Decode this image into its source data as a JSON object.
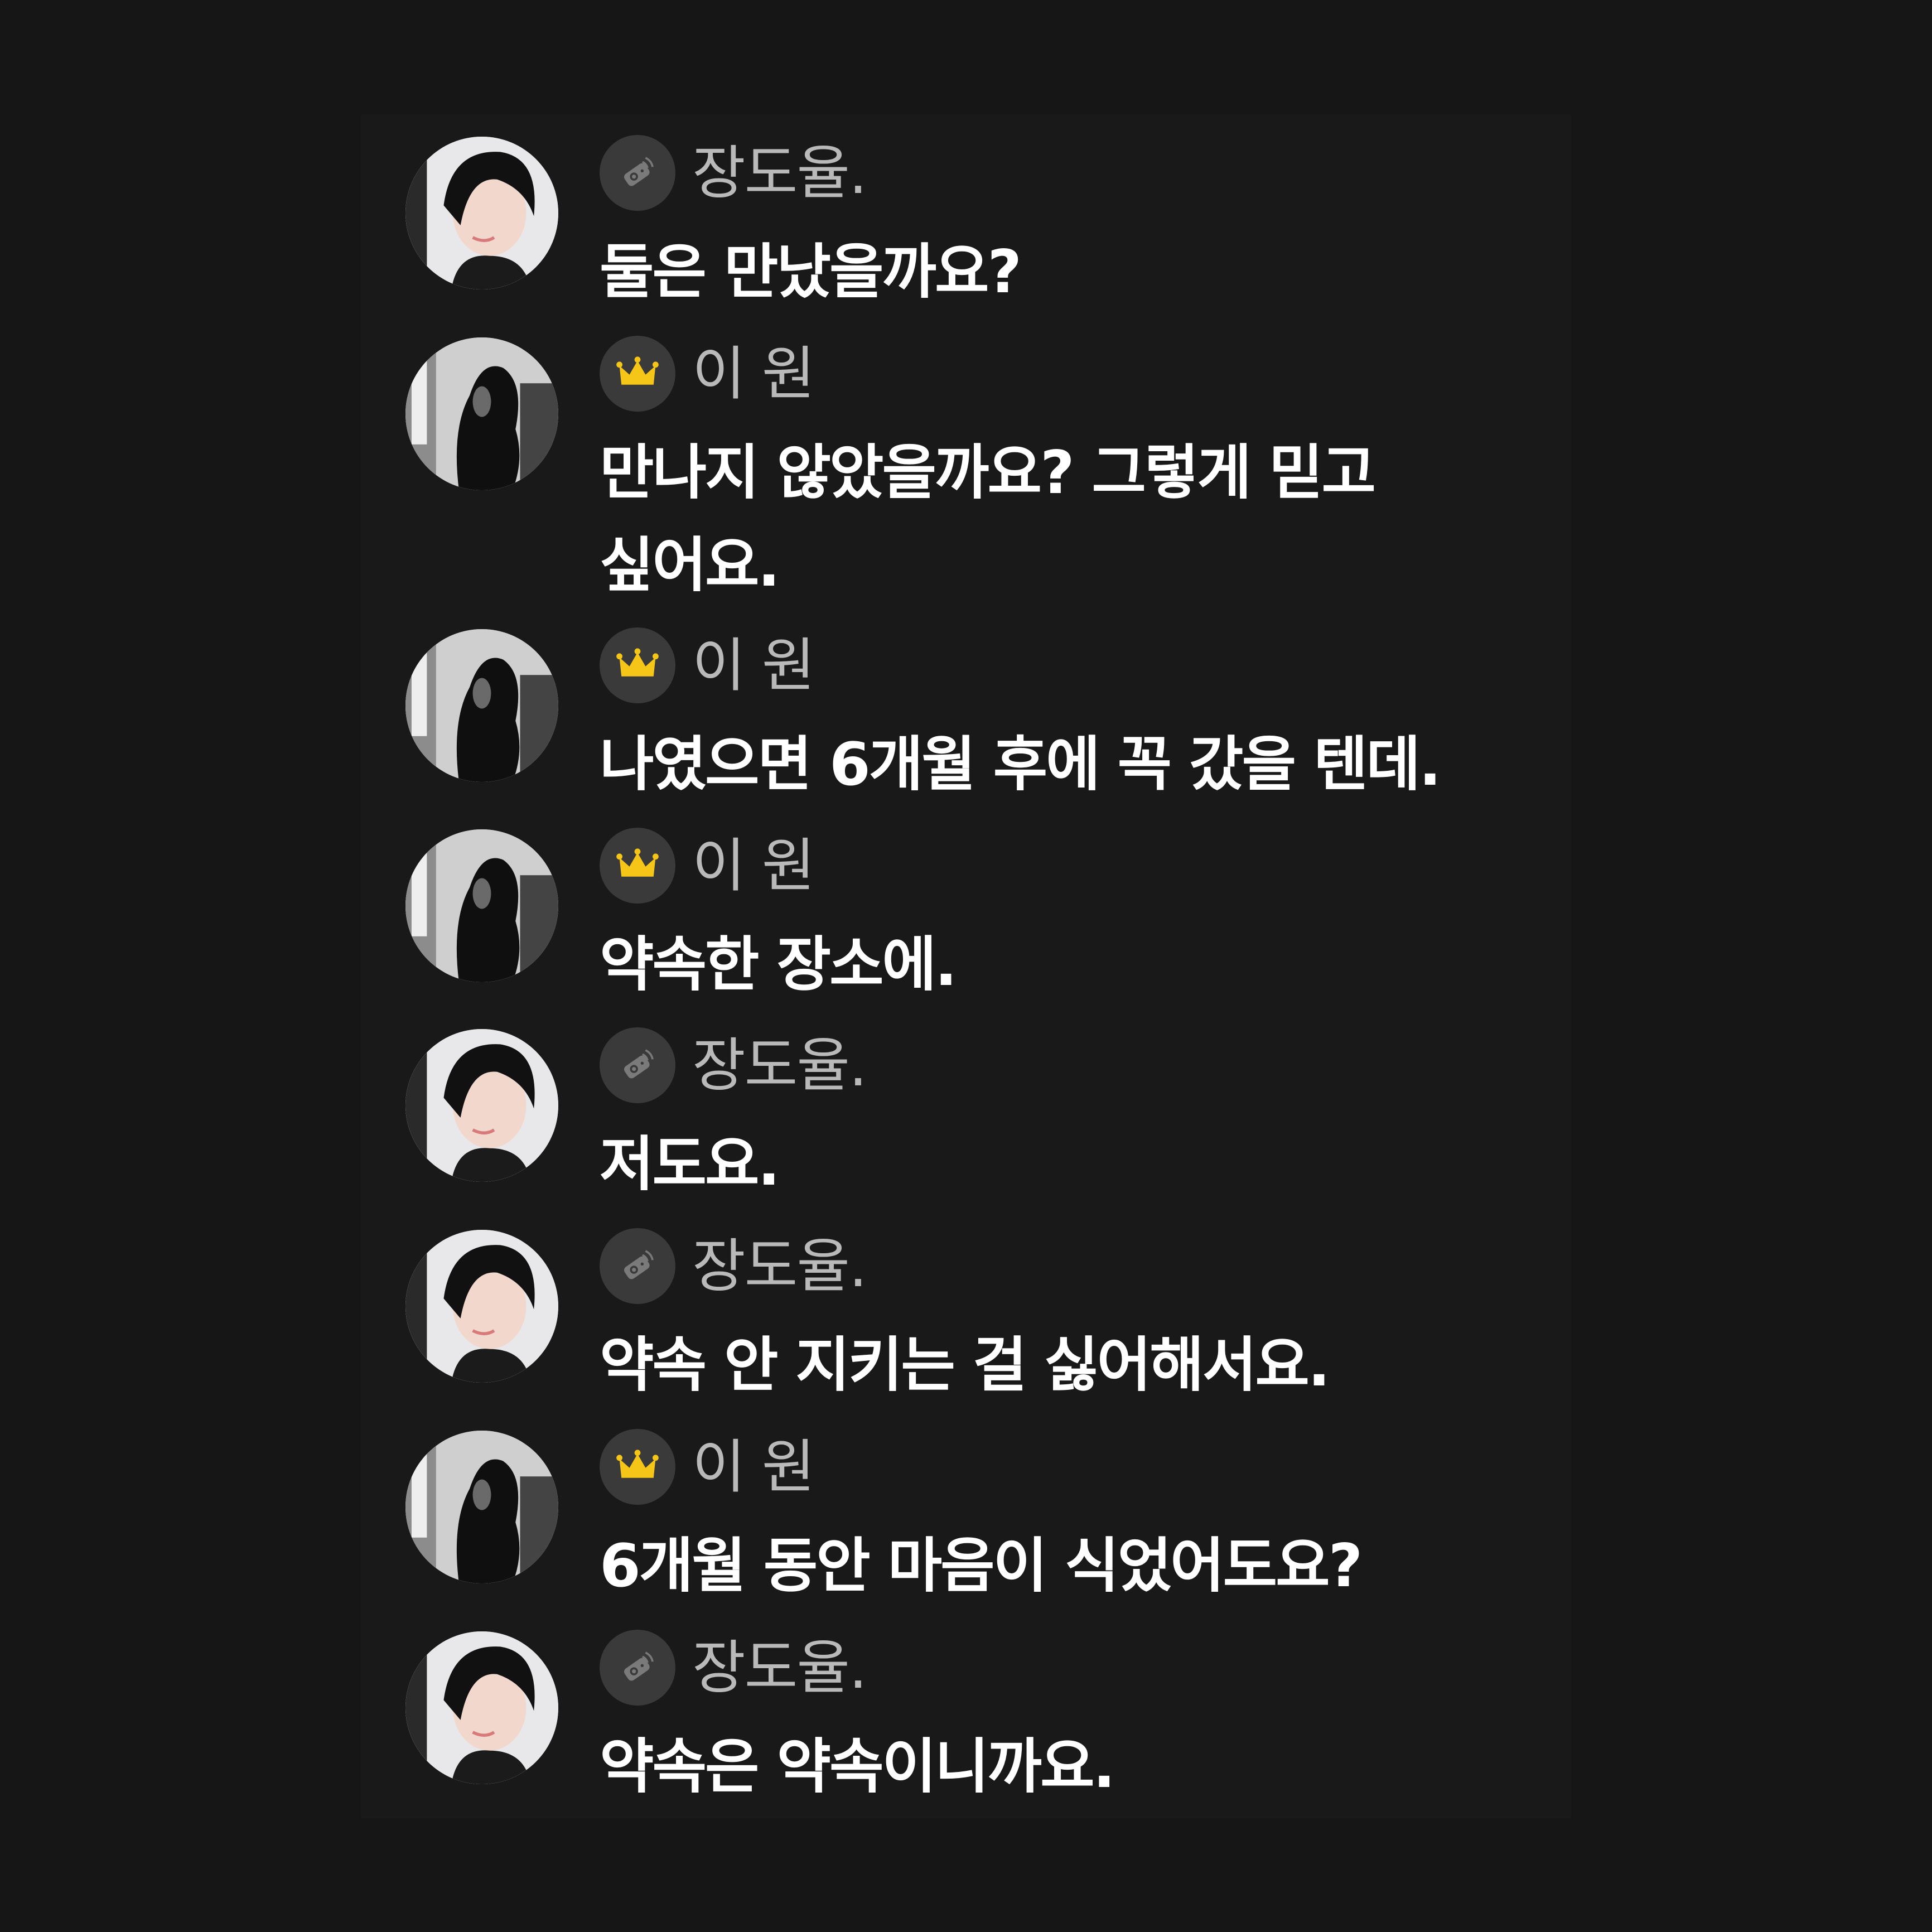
{
  "messages": [
    {
      "sender": "장도율.",
      "badge": "horn-icon",
      "avatar": "man",
      "text": "둘은 만났을까요?"
    },
    {
      "sender": "이 원",
      "badge": "crown-icon",
      "avatar": "woman",
      "text": "만나지 않았을까요? 그렇게 믿고 싶어요."
    },
    {
      "sender": "이 원",
      "badge": "crown-icon",
      "avatar": "woman",
      "text": "나였으면 6개월 후에 꼭 갔을 텐데."
    },
    {
      "sender": "이 원",
      "badge": "crown-icon",
      "avatar": "woman",
      "text": "약속한 장소에."
    },
    {
      "sender": "장도율.",
      "badge": "horn-icon",
      "avatar": "man",
      "text": "저도요."
    },
    {
      "sender": "장도율.",
      "badge": "horn-icon",
      "avatar": "man",
      "text": "약속 안 지키는 걸 싫어해서요."
    },
    {
      "sender": "이 원",
      "badge": "crown-icon",
      "avatar": "woman",
      "text": "6개월 동안 마음이 식었어도요?"
    },
    {
      "sender": "장도율.",
      "badge": "horn-icon",
      "avatar": "man",
      "text": "약속은 약속이니까요."
    }
  ],
  "colors": {
    "background": "#161616",
    "panel": "#191919",
    "badge_bg": "#3a3a3a",
    "crown": "#f5c518",
    "name_text": "#b9b9b9",
    "message_text": "#ffffff"
  }
}
